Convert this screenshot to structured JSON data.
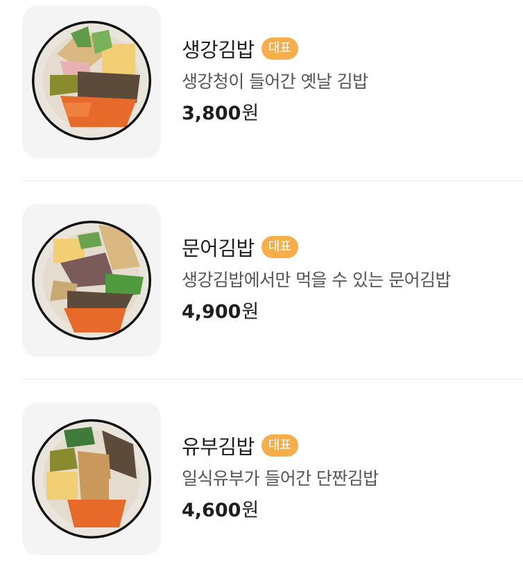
{
  "menu": {
    "items": [
      {
        "name": "생강김밥",
        "badge": "대표",
        "description": "생강청이 들어간 옛날 김밥",
        "price_number": "3,800",
        "price_unit": "원",
        "image_icon": "gimbap-ginger-photo"
      },
      {
        "name": "문어김밥",
        "badge": "대표",
        "description": "생강김밥에서만 먹을 수 있는 문어김밥",
        "price_number": "4,900",
        "price_unit": "원",
        "image_icon": "gimbap-octopus-photo"
      },
      {
        "name": "유부김밥",
        "badge": "대표",
        "description": "일식유부가 들어간 단짠김밥",
        "price_number": "4,600",
        "price_unit": "원",
        "image_icon": "gimbap-tofu-photo"
      }
    ]
  },
  "colors": {
    "badge_bg": "#f5ae4a",
    "thumb_bg": "#f4f4f4",
    "title_text": "#1e1e1e",
    "desc_text": "#555555",
    "divider": "#eeeeee"
  }
}
